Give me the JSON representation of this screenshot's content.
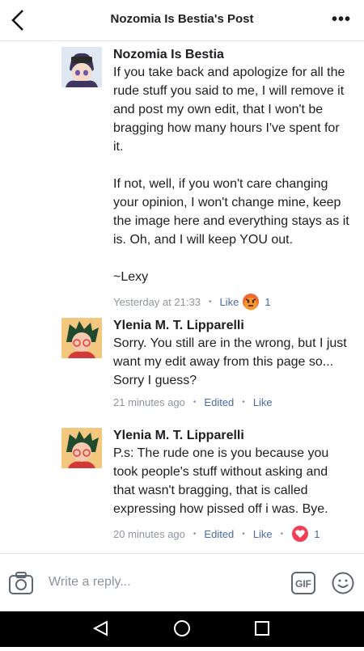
{
  "header": {
    "title": "Nozomia Is Bestia's Post"
  },
  "comments": [
    {
      "author": "Nozomia Is Bestia",
      "text": "If you take back and apologize for all the rude stuff you said to me, I will remove it and post my own edit, that I won't be bragging how many hours I've spent for it.\n\nIf not, well, if you won't care changing your opinion, I won't change mine, keep the image here and everything stays as it is. Oh, and I will keep YOU out.\n\n~Lexy",
      "time": "Yesterday at 21:33",
      "like": "Like",
      "reaction": "angry",
      "reaction_count": "1"
    },
    {
      "author": "Ylenia M. T. Lipparelli",
      "text": "Sorry. You still are in the wrong, but I just want my edit away from this page so... Sorry I guess?",
      "time": "21 minutes ago",
      "edited": "Edited",
      "like": "Like"
    },
    {
      "author": "Ylenia M. T. Lipparelli",
      "text": "P.s: The rude one is you because you took people's stuff without asking and that wasn't bragging, that is called expressing how pissed off i was. Bye.",
      "time": "20 minutes ago",
      "edited": "Edited",
      "like": "Like",
      "reaction": "love",
      "reaction_count": "1"
    }
  ],
  "composer": {
    "placeholder": "Write a reply...",
    "gif": "GIF"
  },
  "colors": {
    "link": "#4b6aa8",
    "meta": "#90949c",
    "angry": "#f0692e",
    "love": "#f33e58"
  }
}
